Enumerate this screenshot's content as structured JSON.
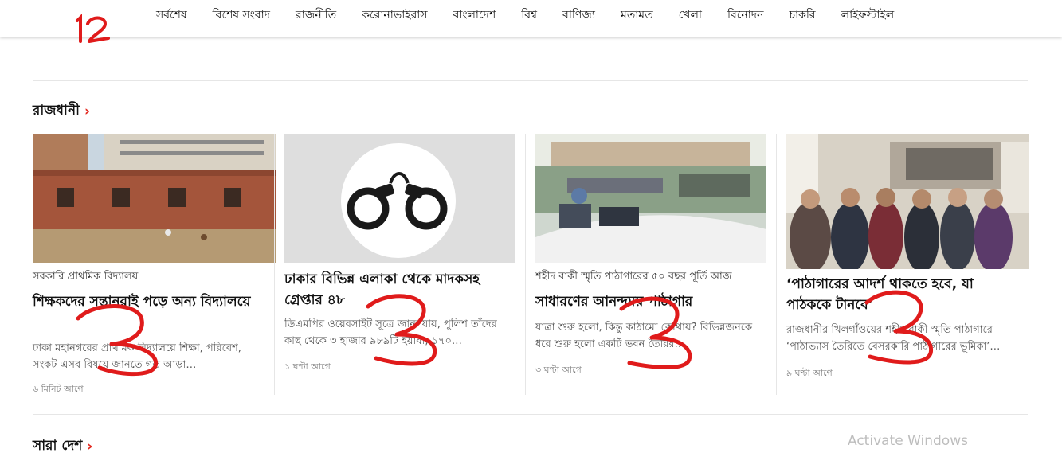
{
  "header": {
    "logo_mark": "১২",
    "nav": [
      "সর্বশেষ",
      "বিশেষ সংবাদ",
      "রাজনীতি",
      "করোনাভাইরাস",
      "বাংলাদেশ",
      "বিশ্ব",
      "বাণিজ্য",
      "মতামত",
      "খেলা",
      "বিনোদন",
      "চাকরি",
      "লাইফস্টাইল"
    ]
  },
  "section": {
    "title": "রাজধানী",
    "chevron": "›"
  },
  "cards": [
    {
      "kicker": "সরকারি প্রাথমিক বিদ্যালয়",
      "headline": "শিক্ষকদের সন্তানরাই পড়ে অন্য বিদ্যালয়ে",
      "summary": "ঢাকা মহানগরের প্রাথমিক বিদ্যালয়ে শিক্ষা, পরিবেশ, সংকট এসব বিষয়ে জানতে গত আড়া…",
      "time": "৬ মিনিট আগে",
      "image": "school-building-photo"
    },
    {
      "kicker": "",
      "headline": "ঢাকার বিভিন্ন এলাকা থেকে মাদকসহ গ্রেপ্তার ৪৮",
      "summary": "ডিএমপির ওয়েবসাইট সূত্রে জানা যায়, পুলিশ তাঁদের কাছ থেকে ৩ হাজার ৯৮৯টি ইয়াবা, ১৭০…",
      "time": "১ ঘণ্টা আগে",
      "image": "handcuffs-illustration"
    },
    {
      "kicker": "শহীদ বাকী স্মৃতি পাঠাগারের ৫০ বছর পূর্তি আজ",
      "headline": "সাধারণের আনন্দময় পাঠাগার",
      "summary": "যাত্রা শুরু হলো, কিন্তু কাঠামো কোথায়? বিভিন্নজনকে ধরে শুরু হলো একটি ভবন তৈরির…",
      "time": "৩ ঘণ্টা আগে",
      "image": "library-reading-room-photo"
    },
    {
      "kicker": "",
      "headline": "‘পাঠাগারের আদর্শ থাকতে হবে, যা পাঠককে টানবে’",
      "summary": "রাজধানীর খিলগাঁওয়ের শহীদ বাকী স্মৃতি পাঠাগারে ‘পাঠাভ্যাস তৈরিতে বেসরকারি পাঠাগারের ভূমিকা’…",
      "time": "৯ ঘণ্টা আগে",
      "image": "people-in-library-photo"
    }
  ],
  "next_section": {
    "title": "সারা দেশ",
    "chevron": "›"
  },
  "os_watermark": "Activate Windows",
  "annotations": {
    "marks": [
      "3",
      "3",
      "3",
      "3"
    ],
    "color": "#e01b1b"
  },
  "colors": {
    "accent": "#e2231a",
    "divider": "#e6e6e6"
  }
}
